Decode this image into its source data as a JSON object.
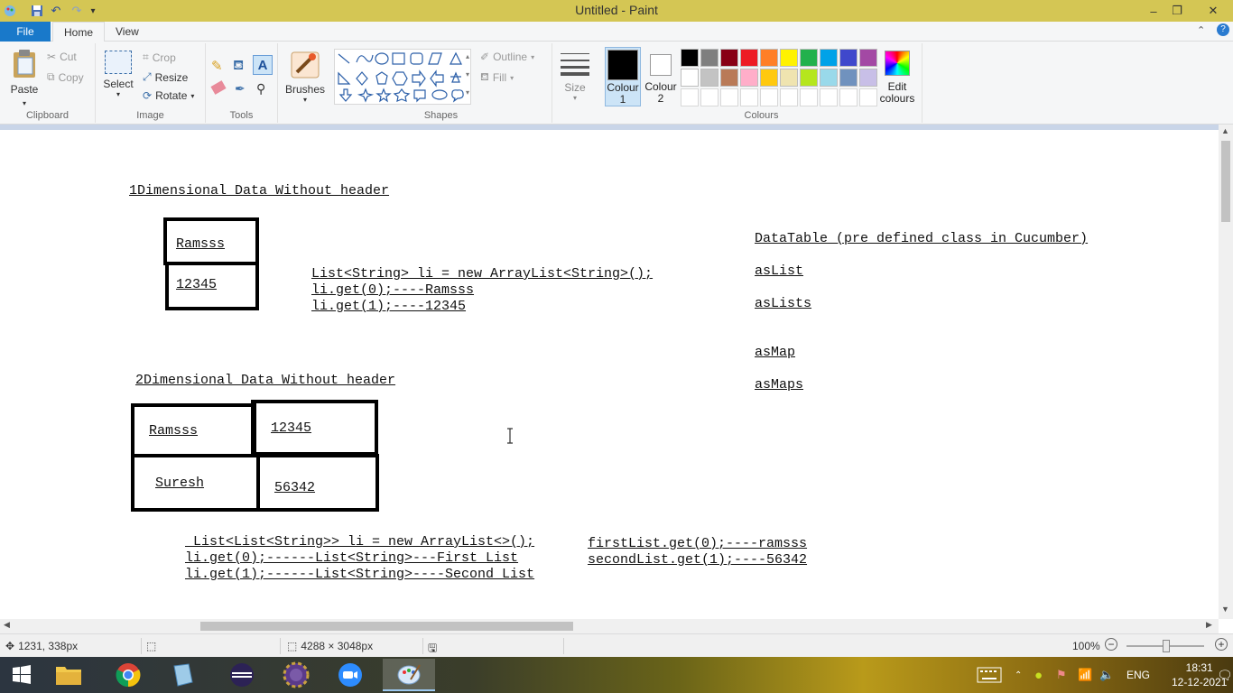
{
  "window": {
    "title": "Untitled - Paint",
    "minimize": "–",
    "restore": "❐",
    "close": "✕"
  },
  "tabs": {
    "file": "File",
    "home": "Home",
    "view": "View"
  },
  "ribbon": {
    "clipboard": {
      "label": "Clipboard",
      "paste": "Paste",
      "cut": "Cut",
      "copy": "Copy"
    },
    "image": {
      "label": "Image",
      "select": "Select",
      "crop": "Crop",
      "resize": "Resize",
      "rotate": "Rotate"
    },
    "tools": {
      "label": "Tools"
    },
    "brushes": {
      "label": "Brushes"
    },
    "shapes": {
      "label": "Shapes",
      "outline": "Outline",
      "fill": "Fill"
    },
    "size": {
      "label": "Size"
    },
    "colours": {
      "label": "Colours",
      "colour1": "Colour\n1",
      "colour1_line1": "Colour",
      "colour1_line2": "1",
      "colour2_line1": "Colour",
      "colour2_line2": "2",
      "edit_line1": "Edit",
      "edit_line2": "colours",
      "colour1_value": "#000000",
      "colour2_value": "#ffffff",
      "palette_row1": [
        "#000000",
        "#7f7f7f",
        "#880015",
        "#ed1c24",
        "#ff7f27",
        "#fff200",
        "#22b14c",
        "#00a2e8",
        "#3f48cc",
        "#a349a4"
      ],
      "palette_row2": [
        "#ffffff",
        "#c3c3c3",
        "#b97a57",
        "#ffaec9",
        "#ffc90e",
        "#efe4b0",
        "#b5e61d",
        "#99d9ea",
        "#7092be",
        "#c8bfe7"
      ]
    }
  },
  "canvas_text": {
    "heading1": "1Dimensional Data Without header",
    "cell_ramsss_1": "Ramsss",
    "cell_12345_1": "12345",
    "code1_line1": "List<String> li = new ArrayList<String>();",
    "code1_line2": "li.get(0);----Ramsss",
    "code1_line3": "li.get(1);----12345",
    "datatable": "DataTable (pre defined class in Cucumber)",
    "aslist": "asList",
    "aslists": "asLists",
    "asmap": "asMap",
    "asmaps": "asMaps",
    "heading2": "2Dimensional Data Without header",
    "cell_ramsss_2": "Ramsss",
    "cell_12345_2": "12345",
    "cell_suresh": "Suresh",
    "cell_56342": "56342",
    "code2_line1": " List<List<String>> li = new ArrayList<>();",
    "code2_line2": "li.get(0);------List<String>---First List",
    "code2_line3": "li.get(1);------List<String>----Second List",
    "code3_line1": "firstList.get(0);----ramsss",
    "code3_line2": "secondList.get(1);----56342"
  },
  "status": {
    "cursor_pos": "1231, 338px",
    "image_size": "4288 × 3048px",
    "zoom": "100%"
  },
  "taskbar": {
    "lang": "ENG",
    "time": "18:31",
    "date": "12-12-2021"
  }
}
